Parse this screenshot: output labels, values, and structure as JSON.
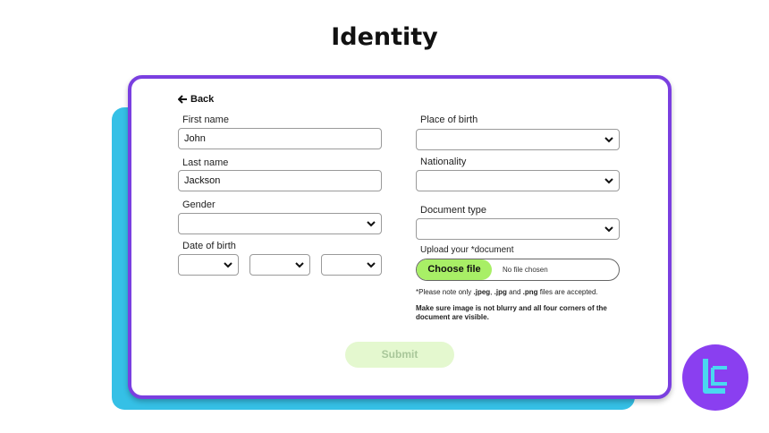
{
  "page": {
    "title": "Identity"
  },
  "form": {
    "back_label": "Back",
    "first_name": {
      "label": "First name",
      "value": "John"
    },
    "last_name": {
      "label": "Last name",
      "value": "Jackson"
    },
    "gender": {
      "label": "Gender",
      "value": ""
    },
    "date_of_birth": {
      "label": "Date of birth",
      "day": "",
      "month": "",
      "year": ""
    },
    "place_of_birth": {
      "label": "Place of birth",
      "value": ""
    },
    "nationality": {
      "label": "Nationality",
      "value": ""
    },
    "document_type": {
      "label": "Document type",
      "value": ""
    },
    "upload": {
      "label": "Upload your *document",
      "button_label": "Choose file",
      "status": "No file chosen"
    },
    "note1": {
      "prefix": "*Please note only ",
      "ext1": ".jpeg",
      "sep1": ", ",
      "ext2": ".jpg",
      "sep2": " and ",
      "ext3": ".png",
      "suffix": " files are accepted."
    },
    "note2": "Make sure image is not blurry and all four corners of the document are visible.",
    "submit_label": "Submit"
  },
  "colors": {
    "card_border": "#7a3fe0",
    "shadow_card": "#35c0e6",
    "choose_button": "#a8ef66",
    "submit_bg": "#e4f8cf",
    "logo_bg": "#8a3ff0",
    "logo_glyph": "#4ad8f0"
  },
  "icons": {
    "back": "arrow-left-icon",
    "dropdown": "chevron-down-icon",
    "logo": "brand-logo-icon"
  }
}
